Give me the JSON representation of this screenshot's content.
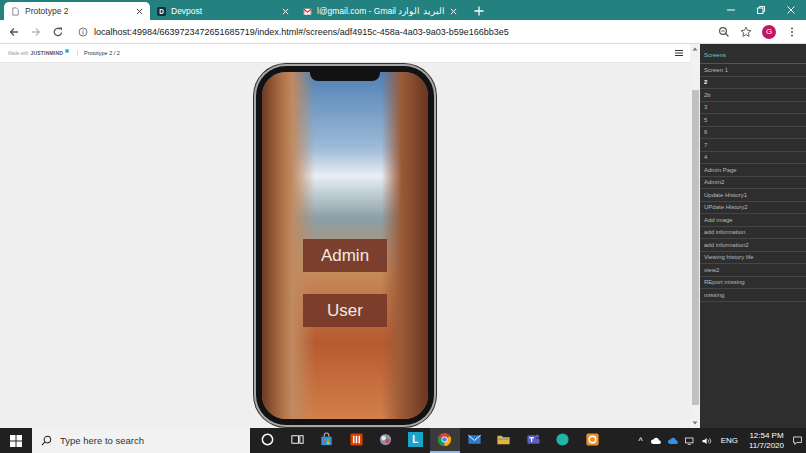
{
  "browser": {
    "tabs": [
      {
        "label": "Prototype 2",
        "selected": true,
        "kind": "page"
      },
      {
        "label": "Devpost",
        "selected": false,
        "kind": "letter",
        "letter": "D"
      },
      {
        "label": "l@gmail.com - Gmail البريد الوارد",
        "selected": false,
        "kind": "gmail"
      }
    ],
    "nav": {
      "back_disabled": false,
      "forward_disabled": true
    },
    "address": {
      "url": "localhost:49984/6639723472651685719/index.html#/screens/adf4915c-458a-4a03-9a03-b59e166bb3e5"
    },
    "profile": {
      "initial": "G"
    }
  },
  "prototype_header": {
    "made_with": "Made with",
    "brand": "JUSTINMIND",
    "breadcrumb": "Prototype 2 / 2"
  },
  "phone": {
    "buttons": [
      "Admin",
      "User"
    ]
  },
  "sidebar": {
    "title": "Screens",
    "items": [
      {
        "label": "Screen 1",
        "selected": false
      },
      {
        "label": "2",
        "selected": true
      },
      {
        "label": "2b",
        "selected": false
      },
      {
        "label": "3",
        "selected": false
      },
      {
        "label": "5",
        "selected": false
      },
      {
        "label": "6",
        "selected": false
      },
      {
        "label": "7",
        "selected": false
      },
      {
        "label": "4",
        "selected": false
      },
      {
        "label": "Admin Page",
        "selected": false
      },
      {
        "label": "Admin2",
        "selected": false
      },
      {
        "label": "Update History1",
        "selected": false
      },
      {
        "label": "UPdate History2",
        "selected": false
      },
      {
        "label": "Add image",
        "selected": false
      },
      {
        "label": "add information",
        "selected": false
      },
      {
        "label": "add information2",
        "selected": false
      },
      {
        "label": "Viewing history life",
        "selected": false
      },
      {
        "label": "view2",
        "selected": false
      },
      {
        "label": "REport missing",
        "selected": false
      },
      {
        "label": "missing",
        "selected": false
      }
    ]
  },
  "taskbar": {
    "search": {
      "placeholder": "Type here to search"
    },
    "apps": [
      {
        "kind": "cortana",
        "color": "#ffffff",
        "open": false
      },
      {
        "kind": "taskview",
        "color": "#ffffff",
        "open": false
      },
      {
        "kind": "store",
        "color": "#3b8fd9",
        "open": false
      },
      {
        "kind": "office",
        "color": "#d83b01",
        "open": false
      },
      {
        "kind": "photos",
        "color": "#8a8fa8",
        "open": false
      },
      {
        "kind": "letter",
        "color": "#1aa3c8",
        "open": false,
        "letter": "L"
      },
      {
        "kind": "chrome",
        "color": "#4285f4",
        "open": true
      },
      {
        "kind": "mail",
        "color": "#2f7ad1",
        "open": false
      },
      {
        "kind": "explorer",
        "color": "#e8b53a",
        "open": false
      },
      {
        "kind": "teams",
        "color": "#5b5fc7",
        "open": false
      },
      {
        "kind": "circle",
        "color": "#1fb5a8",
        "open": false
      },
      {
        "kind": "square",
        "color": "#f0902a",
        "open": false
      }
    ],
    "tray": {
      "expand": "^",
      "language": "ENG",
      "time": "12:54 PM",
      "date": "11/7/2020"
    }
  }
}
